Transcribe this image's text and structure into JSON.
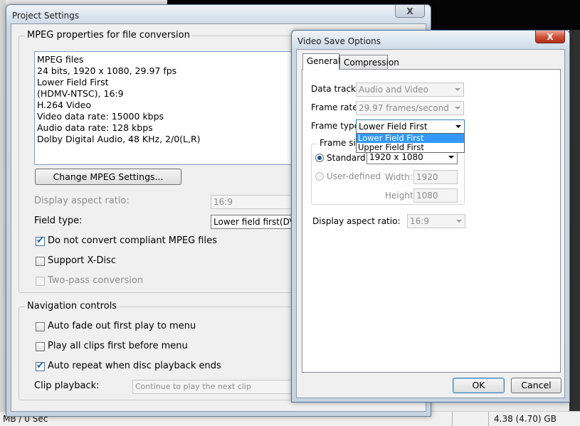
{
  "background": {
    "status_left": "MB / 0 Sec",
    "status_right": "4.38 (4.70) GB"
  },
  "project_settings": {
    "title": "Project Settings",
    "close_label": "X",
    "mpeg_group": {
      "title": "MPEG properties for file conversion",
      "info_lines": [
        "MPEG files",
        "24 bits, 1920 x 1080, 29.97 fps",
        "Lower Field First",
        "(HDMV-NTSC),  16:9",
        "H.264 Video",
        "Video data rate: 15000 kbps",
        "Audio data rate: 128 kbps",
        "Dolby Digital Audio, 48 KHz, 2/0(L,R)"
      ],
      "change_button": "Change MPEG Settings...",
      "display_aspect_label": "Display aspect ratio:",
      "display_aspect_value": "16:9",
      "field_type_label": "Field type:",
      "field_type_value": "Lower field first(DV)",
      "do_not_convert_label": "Do not convert compliant MPEG files",
      "do_not_convert_checked": true,
      "support_xdisc_label": "Support X-Disc",
      "support_xdisc_checked": false,
      "two_pass_label": "Two-pass conversion",
      "two_pass_checked": false
    },
    "nav_group": {
      "title": "Navigation controls",
      "auto_fade_label": "Auto fade out first play to menu",
      "auto_fade_checked": false,
      "play_all_label": "Play all clips first before menu",
      "play_all_checked": false,
      "auto_repeat_label": "Auto repeat when disc playback ends",
      "auto_repeat_checked": true,
      "clip_playback_label": "Clip playback:",
      "clip_playback_value": "Continue to play the next clip"
    }
  },
  "video_save_options": {
    "title": "Video Save Options",
    "close_label": "X",
    "tabs": [
      "General",
      "Compression"
    ],
    "active_tab": "General",
    "data_track_label": "Data track:",
    "data_track_value": "Audio and Video",
    "frame_rate_label": "Frame rate:",
    "frame_rate_value": "29.97 frames/second",
    "frame_type_label": "Frame type:",
    "frame_type_value": "Lower Field First",
    "frame_type_options": [
      "Lower Field First",
      "Upper Field First"
    ],
    "frame_size_title": "Frame size",
    "standard_label": "Standard:",
    "standard_value": "1920 x 1080",
    "user_defined_label": "User-defined",
    "width_label": "Width:",
    "width_value": "1920",
    "height_label": "Height:",
    "height_value": "1080",
    "display_aspect_label": "Display aspect ratio:",
    "display_aspect_value": "16:9",
    "ok_button": "OK",
    "cancel_button": "Cancel"
  }
}
